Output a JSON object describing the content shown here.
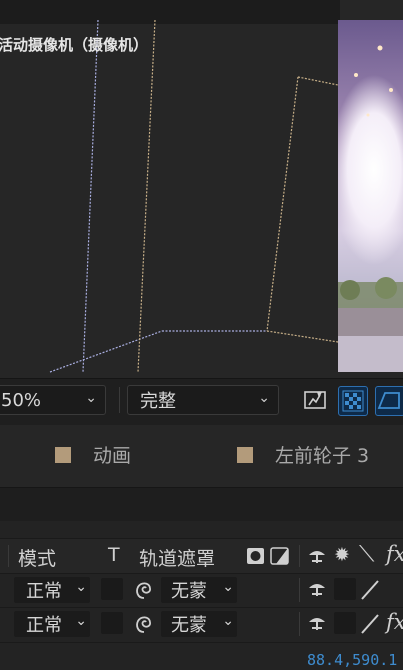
{
  "viewport": {
    "camera_label": "活动摄像机（摄像机）"
  },
  "toolbar": {
    "zoom_value": "50%",
    "resolution_value": "完整",
    "icons": [
      "fast-preview-icon",
      "transparency-grid-icon",
      "mask-path-icon"
    ]
  },
  "legend": {
    "items": [
      {
        "label": "动画",
        "color": "#b39b7b"
      },
      {
        "label": "左前轮子 3",
        "color": "#b39b7b"
      }
    ]
  },
  "timeline": {
    "headers": {
      "mode": "模式",
      "t": "T",
      "track_matte": "轨道遮罩"
    },
    "rows": [
      {
        "mode": "正常",
        "matte": "无蒙"
      },
      {
        "mode": "正常",
        "matte": "无蒙"
      }
    ]
  },
  "footer": {
    "readout": "88.4,590.1"
  },
  "colors": {
    "accent": "#3e8ccf",
    "wire_tan": "#c8b089",
    "wire_blue": "#a9aee0"
  }
}
